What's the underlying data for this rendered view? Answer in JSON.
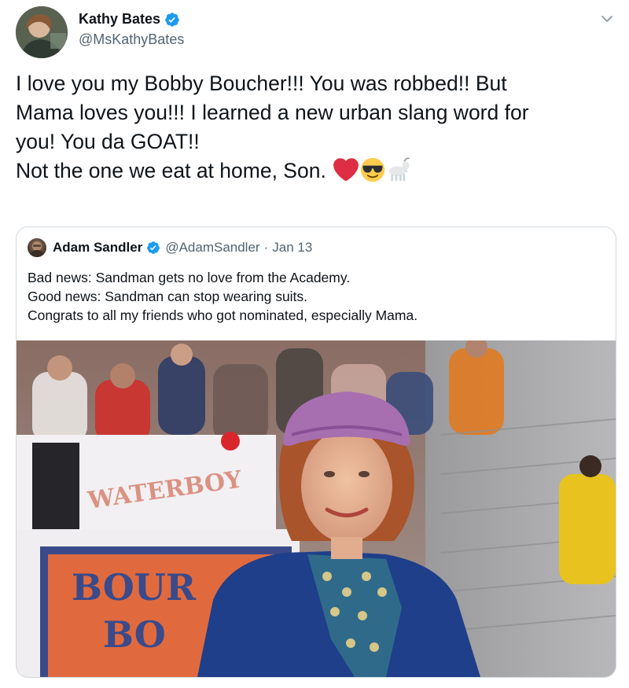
{
  "author": {
    "display_name": "Kathy Bates",
    "handle": "@MsKathyBates"
  },
  "tweet": {
    "lines": [
      "I love you my Bobby Boucher!!! You was robbed!! But",
      "Mama loves you!!! I learned a new urban slang word for",
      "you! You da GOAT!!",
      "Not the one we eat at home, Son."
    ],
    "emojis": [
      "red-heart-emoji",
      "sunglasses-face-emoji",
      "goat-emoji"
    ]
  },
  "quoted_tweet": {
    "display_name": "Adam Sandler",
    "handle": "@AdamSandler",
    "separator": "·",
    "date": "Jan 13",
    "lines": [
      "Bad news: Sandman gets no love from the Academy.",
      "Good news: Sandman can stop wearing suits.",
      "Congrats to all my friends who got nominated, especially Mama."
    ],
    "image": {
      "sign_top": "WATERBOY",
      "sign_bottom_1": "BOUR",
      "sign_bottom_2": "BO"
    }
  },
  "colors": {
    "verified_blue": "#1d9bf0",
    "text_primary": "#0f1419",
    "text_secondary": "#536471",
    "border": "#cfd9de"
  }
}
